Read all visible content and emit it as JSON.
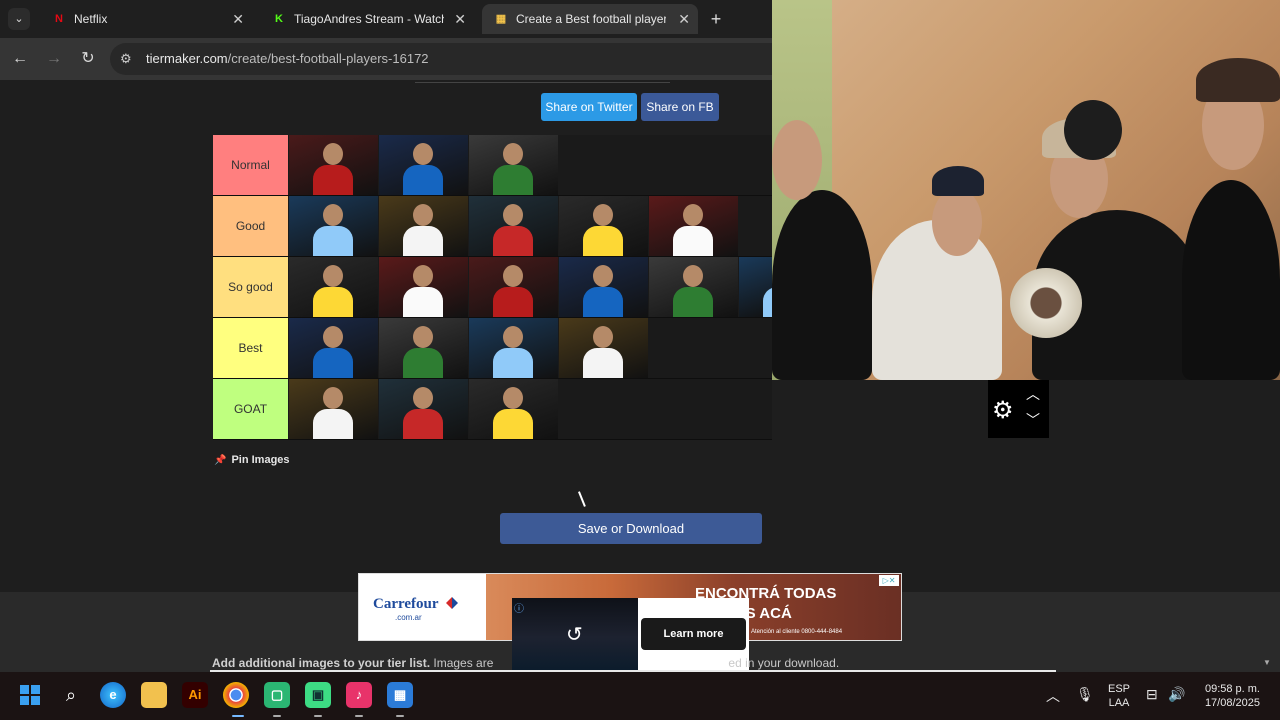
{
  "browser": {
    "tabs": [
      {
        "title": "Netflix",
        "favicon": "N",
        "favicon_color": "#e50914",
        "active": false
      },
      {
        "title": "TiagoAndres Stream - Watch Li",
        "favicon": "K",
        "favicon_color": "#53fc18",
        "active": false
      },
      {
        "title": "Create a Best football players T",
        "favicon": "▦",
        "favicon_color": "#f3c34a",
        "active": true
      }
    ],
    "url_host": "tiermaker.com",
    "url_path": "/create/best-football-players-16172"
  },
  "page": {
    "share_twitter": "Share on Twitter",
    "share_fb": "Share on FB",
    "tiers": [
      {
        "label": "Normal",
        "color": "#ff7f7f",
        "count": 3
      },
      {
        "label": "Good",
        "color": "#ffbf7f",
        "count": 5
      },
      {
        "label": "So good",
        "color": "#ffdf7f",
        "count": 6
      },
      {
        "label": "Best",
        "color": "#ffff7f",
        "count": 4
      },
      {
        "label": "GOAT",
        "color": "#bfff7f",
        "count": 3
      }
    ],
    "pin_images": "Pin Images",
    "save_button": "Save or Download",
    "add_text_bold": "Add additional images to your tier list.",
    "add_text_start": "Images are",
    "add_text_end": "ed in your download."
  },
  "ad": {
    "brand": "Carrefour",
    "brand_sub": ".com.ar",
    "headline_1": "ENCONTRÁ TODAS",
    "headline_2": "ROMOS ACÁ",
    "fine_print": "Atención al cliente 0800-444-8484",
    "learn_more": "Learn more"
  },
  "taskbar": {
    "lang_1": "ESP",
    "lang_2": "LAA",
    "time": "09:58 p. m.",
    "date": "17/08/2025"
  }
}
